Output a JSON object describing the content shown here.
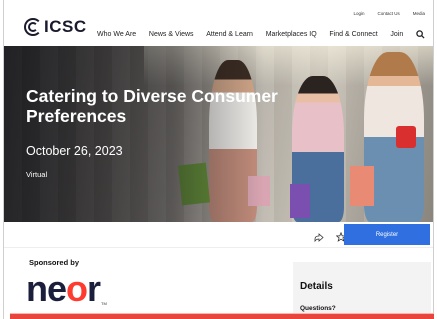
{
  "header": {
    "logo_text": "ICSC",
    "utility": [
      "Login",
      "Contact Us",
      "Media"
    ],
    "nav": [
      "Who We Are",
      "News & Views",
      "Attend & Learn",
      "Marketplaces IQ",
      "Find & Connect",
      "Join"
    ]
  },
  "hero": {
    "title": "Catering to Diverse Consumer Preferences",
    "date": "October 26, 2023",
    "type": "Virtual"
  },
  "actions": {
    "register_label": "Register"
  },
  "sponsor": {
    "label": "Sponsored by",
    "logo_text_a": "ne",
    "logo_text_o": "o",
    "logo_text_b": "r",
    "logo_tm": "TM"
  },
  "details": {
    "title": "Details",
    "questions": "Questions?"
  },
  "colors": {
    "register": "#2f6fe0",
    "banner": "#e8453c",
    "near_accent": "#ff3b2f"
  }
}
